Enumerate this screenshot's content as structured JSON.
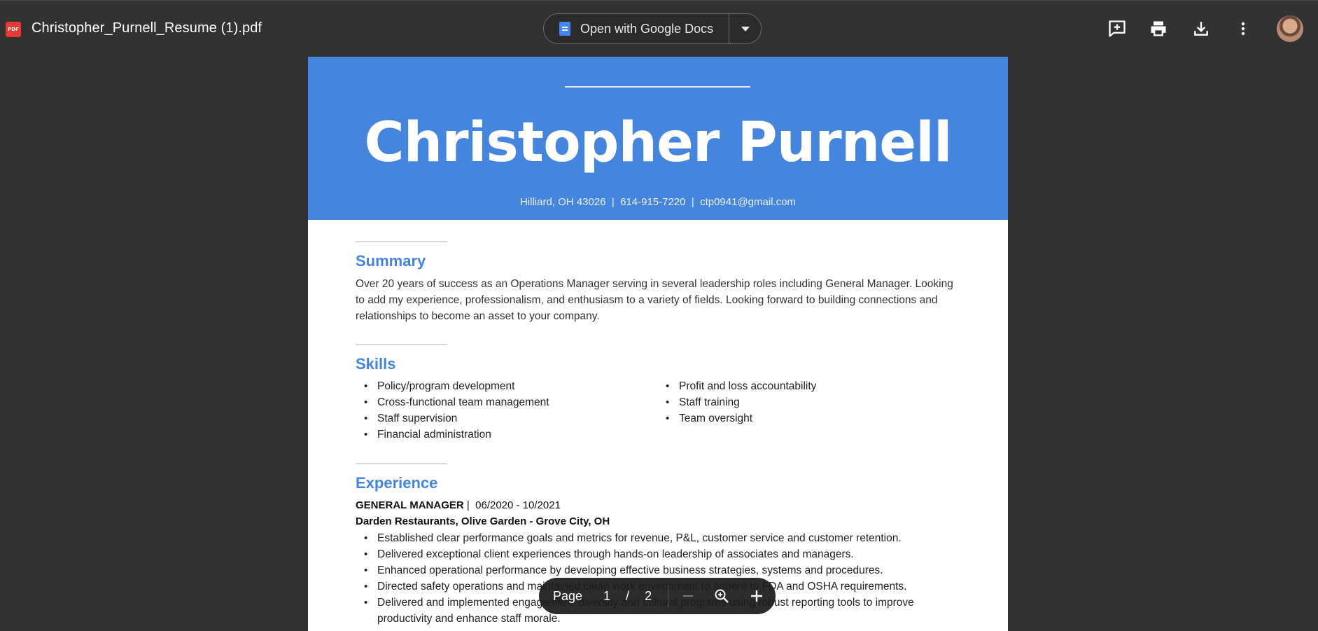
{
  "toolbar": {
    "pdf_badge": "PDF",
    "file_title": "Christopher_Purnell_Resume (1).pdf",
    "open_with_label": "Open with Google Docs",
    "icons": [
      "add-comment-icon",
      "print-icon",
      "download-icon",
      "more-vert-icon"
    ]
  },
  "resume": {
    "name": "Christopher Purnell",
    "contact": "Hilliard, OH 43026  |  614-915-7220  |  ctp0941@gmail.com",
    "summary": {
      "title": "Summary",
      "lines": [
        "Over 20 years of success as an Operations Manager serving in several leadership roles including General Manager. Looking",
        "to add my experience, professionalism, and enthusiasm to a variety of fields. Looking forward to building connections and",
        "relationships to become an asset to your company."
      ]
    },
    "skills": {
      "title": "Skills",
      "left": [
        "Policy/program development",
        "Cross-functional team management",
        "Staff supervision",
        "Financial administration"
      ],
      "right": [
        "Profit and loss accountability",
        "Staff training",
        "Team oversight"
      ]
    },
    "experience": {
      "title": "Experience",
      "job_title": "GENERAL MANAGER",
      "dates": "|  06/2020 - 10/2021",
      "company": "Darden Restaurants, Olive Garden - Grove City, OH",
      "bullets": [
        "Established clear performance goals and metrics for revenue, P&L, customer service and customer retention.",
        "Delivered exceptional client experiences through hands-on leadership of associates and managers.",
        "Enhanced operational performance by developing effective business strategies, systems and procedures.",
        "Directed safety operations and maintained clean work environment to adhere to FDA and OSHA requirements.",
        "Delivered and implemented engagement, diversity and cultural programs using robust reporting tools to improve",
        "productivity and enhance staff morale."
      ]
    }
  },
  "pager": {
    "label": "Page",
    "current": "1",
    "separator": "/",
    "total": "2"
  },
  "colors": {
    "accent": "#4585de",
    "toolbar_bg": "#323232"
  }
}
